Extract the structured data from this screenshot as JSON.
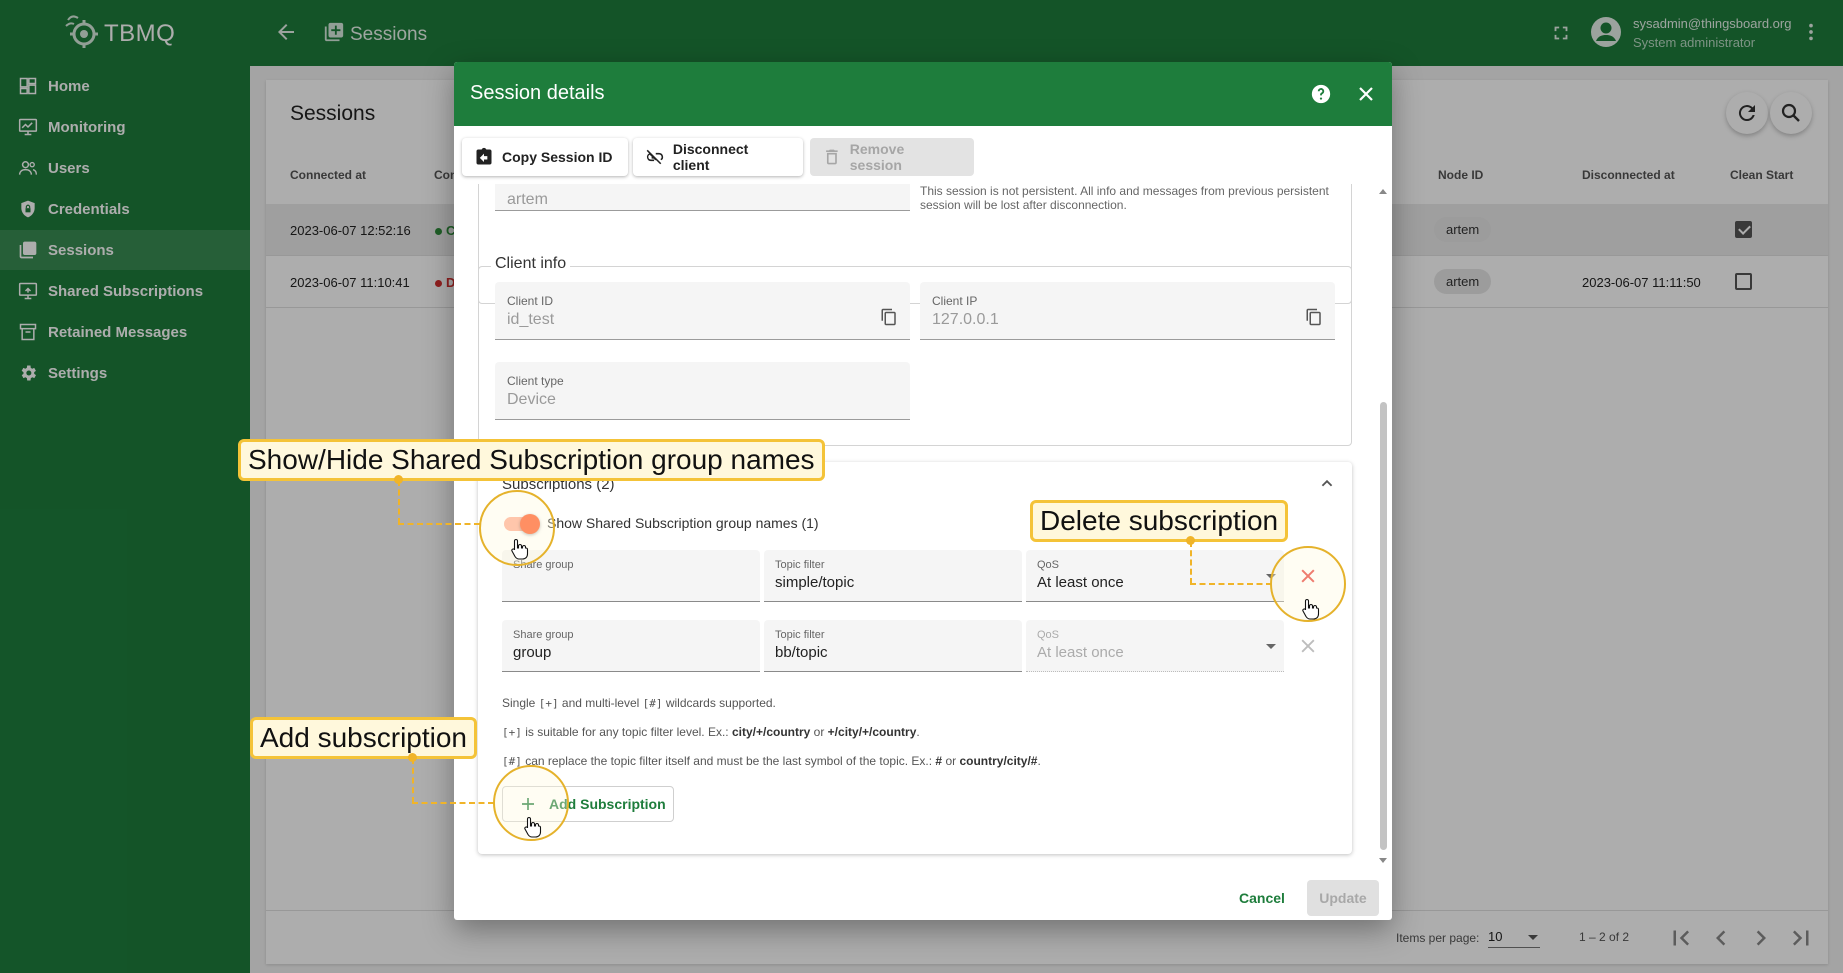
{
  "app": {
    "brand": "TBMQ",
    "breadcrumb": "Sessions"
  },
  "user": {
    "name": "sysadmin@thingsboard.org",
    "role": "System administrator"
  },
  "sidebar": {
    "items": [
      {
        "label": "Home",
        "icon": "dashboard-icon"
      },
      {
        "label": "Monitoring",
        "icon": "monitor-icon"
      },
      {
        "label": "Users",
        "icon": "users-icon"
      },
      {
        "label": "Credentials",
        "icon": "shield-lock-icon"
      },
      {
        "label": "Sessions",
        "icon": "sessions-icon",
        "active": true
      },
      {
        "label": "Shared Subscriptions",
        "icon": "share-screen-icon"
      },
      {
        "label": "Retained Messages",
        "icon": "archive-icon"
      },
      {
        "label": "Settings",
        "icon": "gear-icon"
      }
    ]
  },
  "sessions_page": {
    "title": "Sessions",
    "columns": {
      "connected_at": "Connected at",
      "con": "Con",
      "node_id": "Node ID",
      "disconnected_at": "Disconnected at",
      "clean_start": "Clean Start"
    },
    "rows": [
      {
        "connected_at": "2023-06-07 12:52:16",
        "con": "C",
        "status_color": "#2e8b3a",
        "node_id": "artem",
        "disconnected_at": "",
        "clean_start": true
      },
      {
        "connected_at": "2023-06-07 11:10:41",
        "con": "D",
        "status_color": "#d32f2f",
        "node_id": "artem",
        "disconnected_at": "2023-06-07 11:11:50",
        "clean_start": false
      }
    ],
    "paginator": {
      "items_per_page_label": "Items per page:",
      "items_per_page": "10",
      "range": "1 – 2 of 2"
    }
  },
  "dialog": {
    "title": "Session details",
    "toolbar": {
      "copy_session_id": "Copy Session ID",
      "disconnect_client": "Disconnect client",
      "remove_session": "Remove session"
    },
    "session": {
      "value": "artem",
      "hint": "This session is not persistent. All info and messages from previous persistent session will be lost after disconnection."
    },
    "client_info": {
      "legend": "Client info",
      "client_id": {
        "label": "Client ID",
        "value": "id_test"
      },
      "client_ip": {
        "label": "Client IP",
        "value": "127.0.0.1"
      },
      "client_type": {
        "label": "Client type",
        "value": "Device"
      }
    },
    "subscriptions": {
      "title": "Subscriptions (2)",
      "toggle_label": "Show Shared Subscription group names (1)",
      "toggle_on": true,
      "items": [
        {
          "share_group_label": "Share group",
          "share_group": "",
          "topic_label": "Topic filter",
          "topic": "simple/topic",
          "qos_label": "QoS",
          "qos": "At least once",
          "disabled": false
        },
        {
          "share_group_label": "Share group",
          "share_group": "group",
          "topic_label": "Topic filter",
          "topic": "bb/topic",
          "qos_label": "QoS",
          "qos": "At least once",
          "disabled": true
        }
      ],
      "hint_1": {
        "pre": "Single ",
        "plus": "[+]",
        "mid": " and multi-level ",
        "hash": "[#]",
        "post": " wildcards supported."
      },
      "hint_2": {
        "plus": "[+]",
        "text": " is suitable for any topic filter level. Ex.: ",
        "ex1": "city/+/country",
        "or": " or ",
        "ex2": "+/city/+/country",
        "end": "."
      },
      "hint_3": {
        "hash": "[#]",
        "text": " can replace the topic filter itself and must be the last symbol of the topic. Ex.: ",
        "ex1": "#",
        "or": " or ",
        "ex2": "country/city/#",
        "end": "."
      },
      "add_button": "Add Subscription"
    },
    "actions": {
      "cancel": "Cancel",
      "update": "Update"
    }
  },
  "callouts": {
    "toggle": "Show/Hide Shared Subscription group names",
    "delete": "Delete subscription",
    "add": "Add subscription"
  },
  "colors": {
    "brand": "#1e7d3c",
    "accent": "#ff5722",
    "danger": "#e53935",
    "callout_border": "#f4c338"
  }
}
